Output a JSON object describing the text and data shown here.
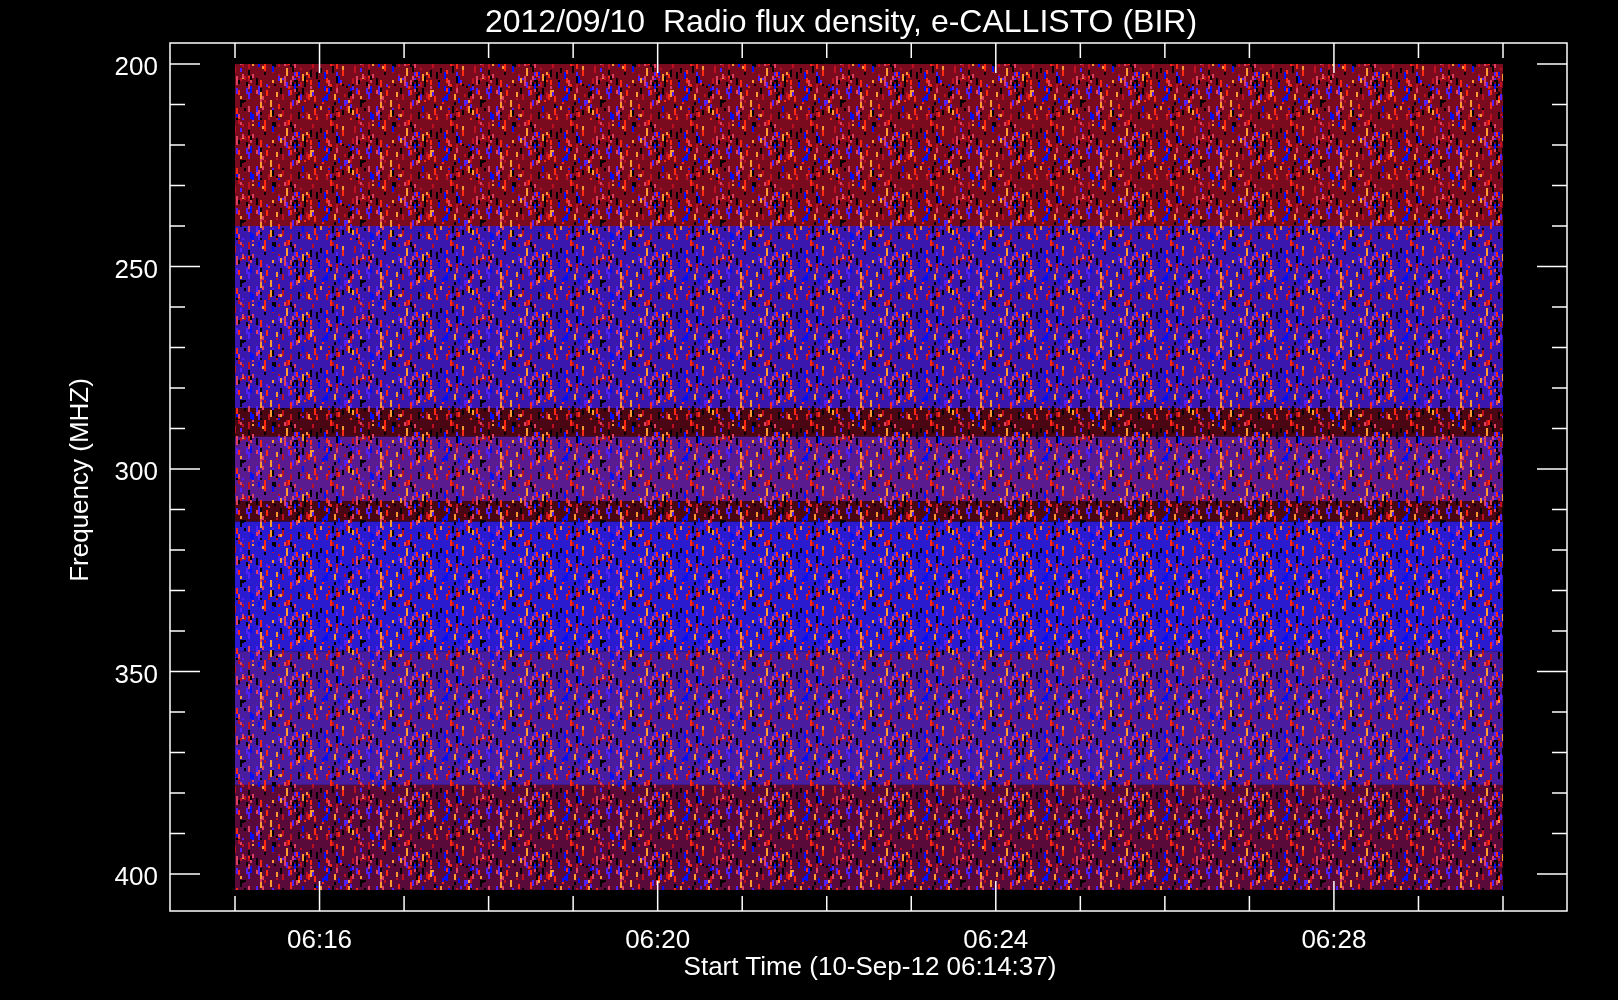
{
  "plot": {
    "title": "2012/09/10  Radio flux density, e-CALLISTO (BIR)",
    "ylabel": "Frequency (MHZ)",
    "xlabel": "Start Time (10-Sep-12 06:14:37)",
    "y_tick_labels": [
      "200",
      "250",
      "300",
      "350",
      "400"
    ],
    "x_tick_labels": [
      "06:16",
      "06:20",
      "06:24",
      "06:28"
    ]
  }
}
